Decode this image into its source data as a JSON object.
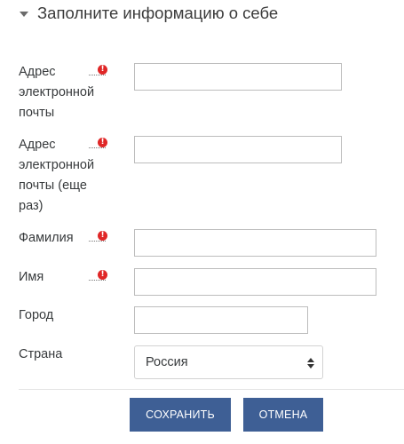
{
  "section": {
    "title": "Заполните информацию о себе"
  },
  "fields": {
    "email": {
      "label": "Адрес электронной почты",
      "value": "",
      "required": true
    },
    "email_again": {
      "label": "Адрес электронной почты (еще раз)",
      "value": "",
      "required": true
    },
    "lastname": {
      "label": "Фамилия",
      "value": "",
      "required": true
    },
    "firstname": {
      "label": "Имя",
      "value": "",
      "required": true
    },
    "city": {
      "label": "Город",
      "value": "",
      "required": false
    },
    "country": {
      "label": "Страна",
      "selected": "Россия",
      "required": false
    }
  },
  "required_icon_glyph": "!",
  "buttons": {
    "save": "СОХРАНИТЬ",
    "cancel": "ОТМЕНА"
  },
  "colors": {
    "primary_button": "#3e5f95",
    "required_icon": "#e02727"
  },
  "icons": {
    "section_toggle": "caret-down-icon",
    "required": "exclamation-circle-icon",
    "select_arrows": "sort-arrows-icon"
  }
}
